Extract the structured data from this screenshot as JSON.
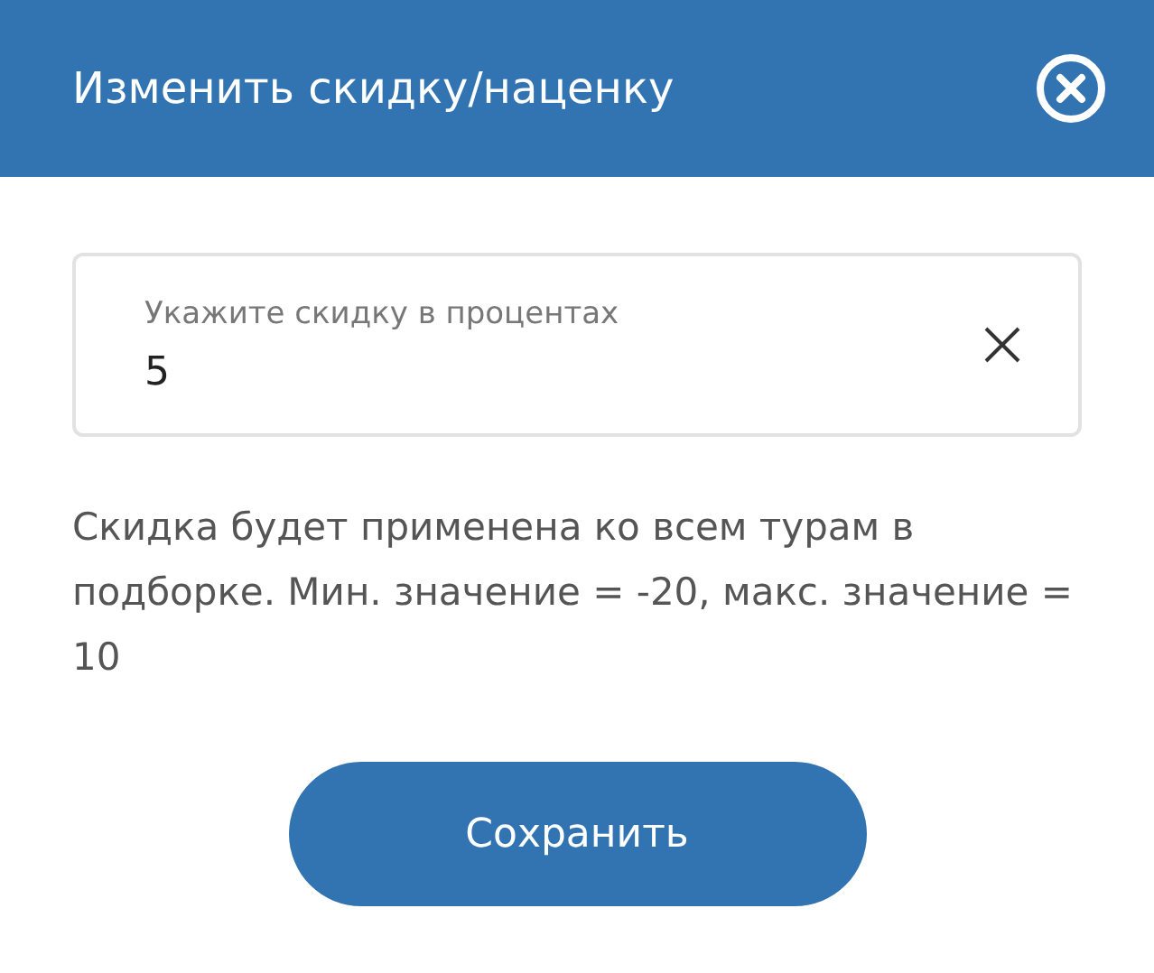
{
  "window": {
    "title": "Изменить скидку/наценку"
  },
  "field": {
    "label": "Укажите скидку в процентах",
    "value": "5"
  },
  "hint": "Скидка будет применена ко всем турам в подборке. Мин. значение = -20, макс. значение = 10",
  "buttons": [
    "Сохранить"
  ]
}
